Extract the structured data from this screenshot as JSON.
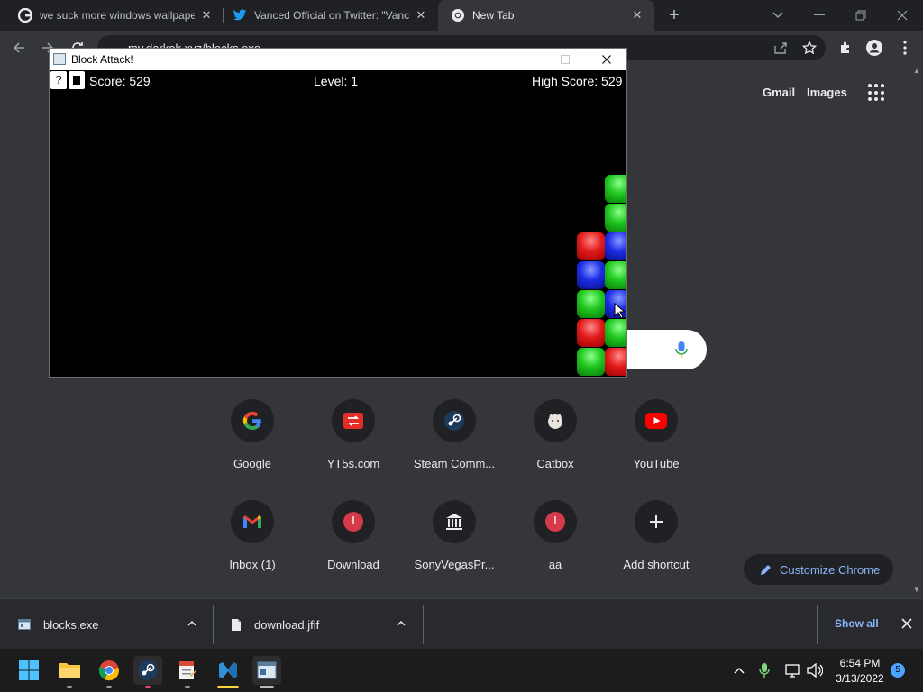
{
  "browser": {
    "tabs": [
      {
        "title": "we suck more windows wallpape",
        "icon": "google-icon",
        "active": false
      },
      {
        "title": "Vanced Official on Twitter: \"Vanc",
        "icon": "twitter-icon",
        "active": false
      },
      {
        "title": "New Tab",
        "icon": "chrome-icon",
        "active": true
      }
    ],
    "address": "my.darkok.xyz/blocks.exe"
  },
  "ntp": {
    "gmail": "Gmail",
    "images": "Images",
    "shortcuts": [
      {
        "label": "Google",
        "icon": "google-icon"
      },
      {
        "label": "YT5s.com",
        "icon": "yt5s-icon"
      },
      {
        "label": "Steam Comm...",
        "icon": "steam-icon"
      },
      {
        "label": "Catbox",
        "icon": "catbox-icon"
      },
      {
        "label": "YouTube",
        "icon": "youtube-icon"
      },
      {
        "label": "Inbox (1)",
        "icon": "gmail-icon"
      },
      {
        "label": "Download",
        "icon": "download-site-icon"
      },
      {
        "label": "SonyVegasPr...",
        "icon": "museum-icon"
      },
      {
        "label": "aa",
        "icon": "aa-site-icon"
      },
      {
        "label": "Add shortcut",
        "icon": "plus-icon"
      }
    ],
    "customize": "Customize Chrome"
  },
  "downloads": {
    "items": [
      {
        "name": "blocks.exe"
      },
      {
        "name": "download.jfif"
      }
    ],
    "show_all": "Show all"
  },
  "game": {
    "title": "Block Attack!",
    "help_label": "?",
    "score": "Score: 529",
    "level": "Level: 1",
    "high_score": "High Score: 529",
    "columns": [
      {
        "column": 1,
        "blocks_bottom_to_top": [
          "green",
          "red",
          "green",
          "blue",
          "red"
        ]
      },
      {
        "column": 2,
        "blocks_bottom_to_top": [
          "red",
          "green",
          "blue",
          "green",
          "blue",
          "green",
          "green"
        ]
      }
    ]
  },
  "taskbar": {
    "time": "6:54 PM",
    "date": "3/13/2022",
    "notifications": "5"
  }
}
